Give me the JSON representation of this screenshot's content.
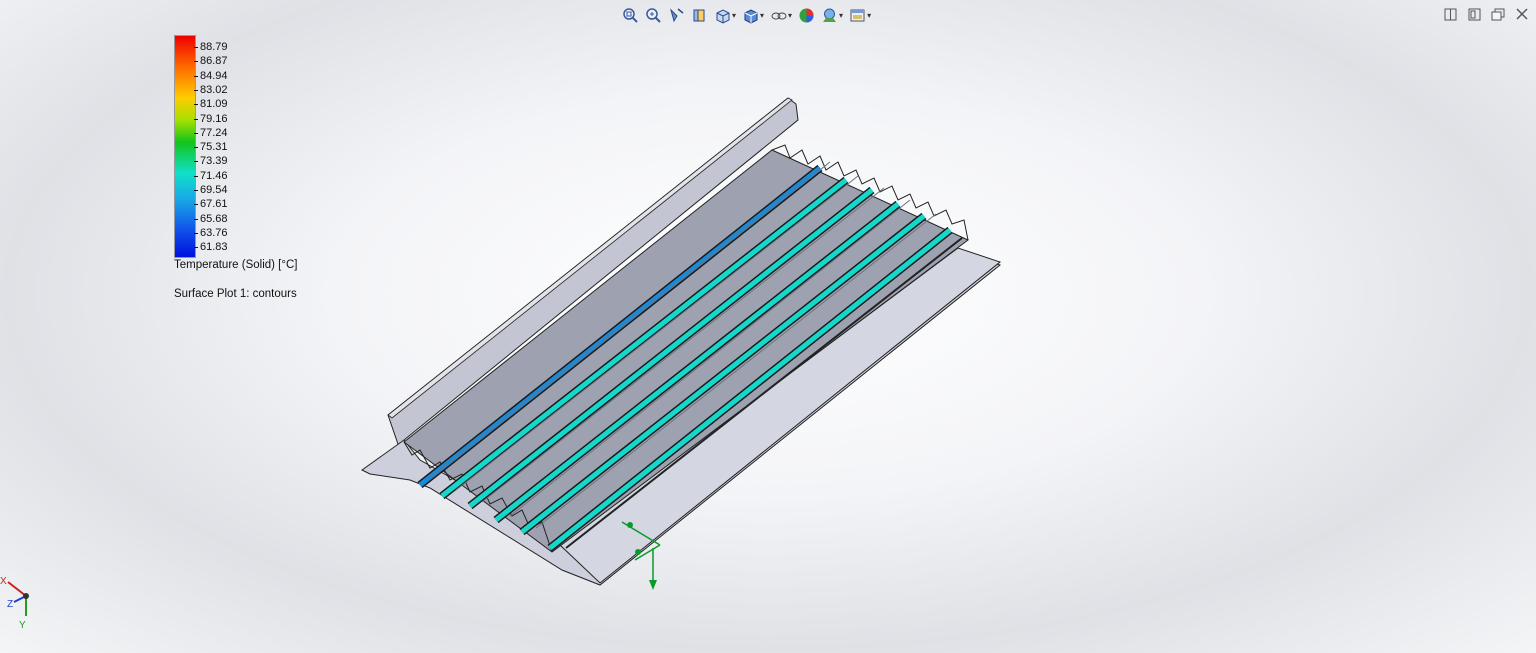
{
  "toolbar": {
    "items": [
      {
        "name": "zoom-to-fit-icon"
      },
      {
        "name": "zoom-to-area-icon"
      },
      {
        "name": "previous-view-icon"
      },
      {
        "name": "section-view-icon"
      },
      {
        "name": "view-orientation-icon",
        "dropdown": true
      },
      {
        "name": "display-style-icon",
        "dropdown": true
      },
      {
        "name": "hide-show-items-icon",
        "dropdown": true
      },
      {
        "name": "edit-appearance-icon"
      },
      {
        "name": "apply-scene-icon",
        "dropdown": true
      },
      {
        "name": "view-settings-icon",
        "dropdown": true
      }
    ]
  },
  "window_controls": [
    "tile-horizontal-icon",
    "tile-vertical-icon",
    "restore-icon",
    "close-icon"
  ],
  "legend": {
    "values": [
      "88.79",
      "86.87",
      "84.94",
      "83.02",
      "81.09",
      "79.16",
      "77.24",
      "75.31",
      "73.39",
      "71.46",
      "69.54",
      "67.61",
      "65.68",
      "63.76",
      "61.83"
    ],
    "title": "Temperature (Solid) [°C]",
    "subtitle": "Surface Plot 1: contours",
    "colors": {
      "max": "#ee0000",
      "mid": "#12c41a",
      "cyan": "#10e0c8",
      "min": "#0010e0"
    }
  },
  "triad": {
    "x_label": "X",
    "y_label": "Y",
    "z_label": "Z"
  },
  "model": {
    "description_colors": {
      "body": "#c9ccd6",
      "fins": "#14d8cc",
      "fin_dark": "#1a8ad8",
      "edges": "#222222",
      "axis": "#0a9a2a"
    }
  }
}
